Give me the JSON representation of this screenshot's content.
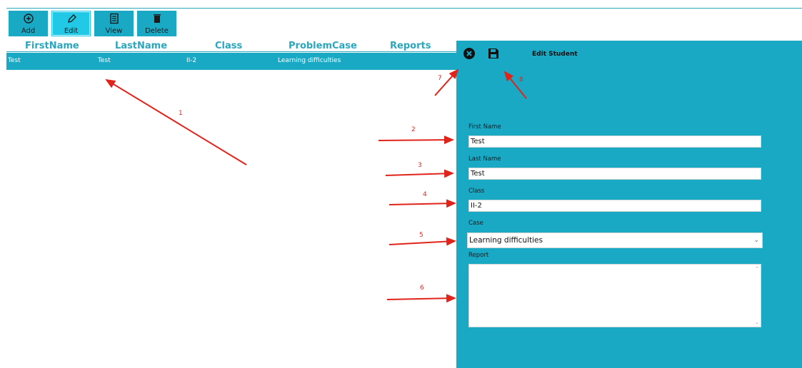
{
  "toolbar": {
    "add_label": "Add",
    "edit_label": "Edit",
    "view_label": "View",
    "delete_label": "Delete"
  },
  "table": {
    "columns": [
      "FirstName",
      "LastName",
      "Class",
      "ProblemCase",
      "Reports"
    ],
    "rows": [
      [
        "Test",
        "Test",
        "II-2",
        "Learning difficulties",
        ""
      ]
    ]
  },
  "edit_panel": {
    "title": "Edit Student",
    "first_name_label": "First Name",
    "first_name_value": "Test",
    "last_name_label": "Last Name",
    "last_name_value": "Test",
    "class_label": "Class",
    "class_value": "II-2",
    "case_label": "Case",
    "case_selected": "Learning difficulties",
    "report_label": "Report",
    "report_value": ""
  },
  "annotations": [
    "1",
    "2",
    "3",
    "4",
    "5",
    "6",
    "7",
    "8"
  ],
  "colors": {
    "accent": "#1aa9c5",
    "header_text": "#2aa6bd",
    "annotation": "#e0241b"
  }
}
